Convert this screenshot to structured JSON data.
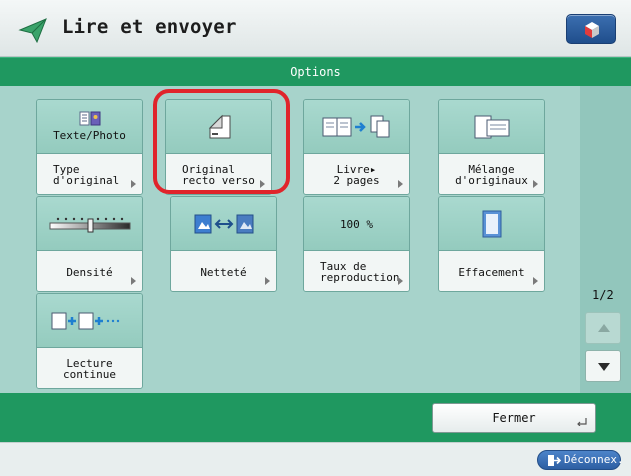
{
  "header": {
    "title": "Lire et envoyer"
  },
  "options_bar": {
    "label": "Options"
  },
  "tiles": [
    {
      "value": "Texte/Photo",
      "label": "Type\nd'original"
    },
    {
      "value": "",
      "label": "Original\nrecto verso"
    },
    {
      "value": "",
      "label": "Livre▸\n2 pages"
    },
    {
      "value": "",
      "label": "Mélange\nd'originaux"
    },
    {
      "value": "",
      "label": "Densité"
    },
    {
      "value": "",
      "label": "Netteté"
    },
    {
      "value": "100 %",
      "label": "Taux de\nreproduction"
    },
    {
      "value": "",
      "label": "Effacement"
    },
    {
      "value": "",
      "label": "Lecture\ncontinue"
    }
  ],
  "pagination": {
    "indicator": "1/2"
  },
  "footer": {
    "close_label": "Fermer",
    "logout_label": "Déconnex."
  },
  "colors": {
    "green": "#1f9860",
    "panel": "#a7d3cb",
    "highlight": "#e0242b",
    "accent_blue": "#2d5fa3"
  }
}
